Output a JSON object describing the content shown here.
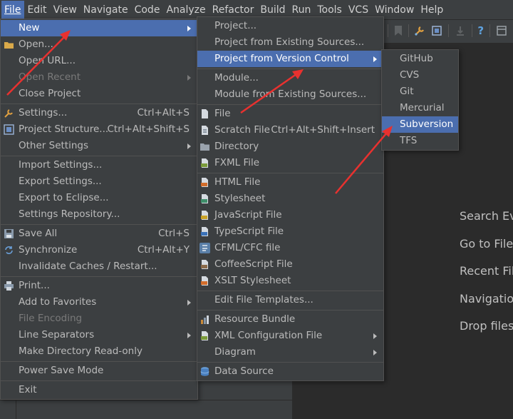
{
  "menubar": [
    "File",
    "Edit",
    "View",
    "Navigate",
    "Code",
    "Analyze",
    "Refactor",
    "Build",
    "Run",
    "Tools",
    "VCS",
    "Window",
    "Help"
  ],
  "file_menu": {
    "new": "New",
    "open": "Open...",
    "open_url": "Open URL...",
    "open_recent": "Open Recent",
    "close_project": "Close Project",
    "settings": "Settings...",
    "settings_sc": "Ctrl+Alt+S",
    "project_structure": "Project Structure...",
    "project_structure_sc": "Ctrl+Alt+Shift+S",
    "other_settings": "Other Settings",
    "import_settings": "Import Settings...",
    "export_settings": "Export Settings...",
    "export_eclipse": "Export to Eclipse...",
    "settings_repo": "Settings Repository...",
    "save_all": "Save All",
    "save_all_sc": "Ctrl+S",
    "synchronize": "Synchronize",
    "synchronize_sc": "Ctrl+Alt+Y",
    "invalidate": "Invalidate Caches / Restart...",
    "print": "Print...",
    "add_favorites": "Add to Favorites",
    "file_encoding": "File Encoding",
    "line_separators": "Line Separators",
    "make_readonly": "Make Directory Read-only",
    "power_save": "Power Save Mode",
    "exit": "Exit"
  },
  "new_menu": {
    "project": "Project...",
    "project_existing": "Project from Existing Sources...",
    "project_vcs": "Project from Version Control",
    "module": "Module...",
    "module_existing": "Module from Existing Sources...",
    "file": "File",
    "scratch": "Scratch File",
    "scratch_sc": "Ctrl+Alt+Shift+Insert",
    "directory": "Directory",
    "fxml": "FXML File",
    "html": "HTML File",
    "stylesheet": "Stylesheet",
    "javascript": "JavaScript File",
    "typescript": "TypeScript File",
    "cfml": "CFML/CFC file",
    "coffeescript": "CoffeeScript File",
    "xslt": "XSLT Stylesheet",
    "edit_templates": "Edit File Templates...",
    "resource_bundle": "Resource Bundle",
    "xml_config": "XML Configuration File",
    "diagram": "Diagram",
    "data_source": "Data Source"
  },
  "vcs_menu": [
    "GitHub",
    "CVS",
    "Git",
    "Mercurial",
    "Subversion",
    "TFS"
  ],
  "editor_hints": [
    "Search Eve",
    "Go to File",
    "Recent File",
    "Navigation",
    "Drop files"
  ],
  "colors": {
    "selection": "#4b6eaf",
    "annotation_arrow": "#e8312f"
  }
}
